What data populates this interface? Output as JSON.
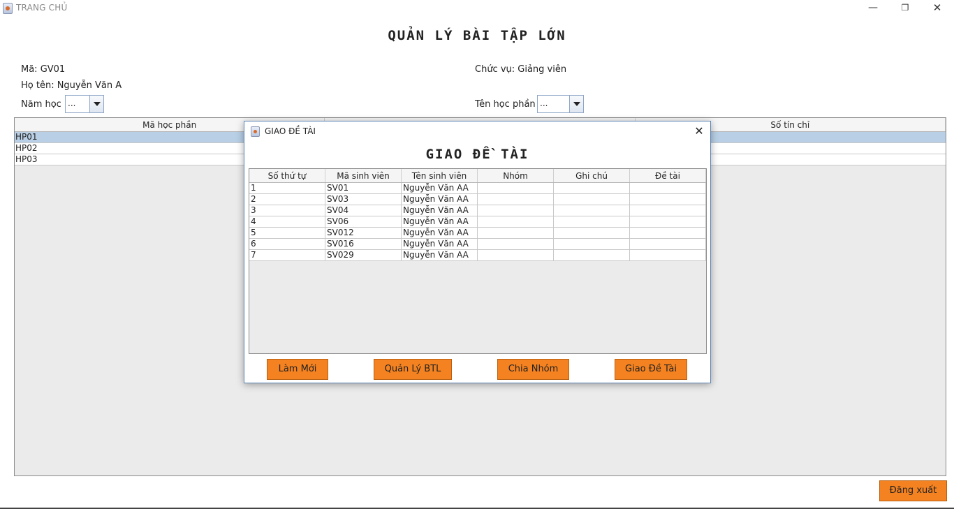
{
  "window": {
    "title": "TRANG CHỦ",
    "minimize": "—",
    "restore": "❐",
    "close": "✕"
  },
  "heading": "QUẢN LÝ BÀI TẬP LỚN",
  "info": {
    "ma": "Mã: GV01",
    "ho_ten": "Họ tên: Nguyễn Văn A",
    "chuc_vu": "Chức vụ: Giảng viên",
    "nam_hoc_label": "Năm học",
    "nam_hoc_value": "...",
    "ten_hoc_phan_label": "Tên học phần",
    "ten_hoc_phan_value": "..."
  },
  "main_table": {
    "columns": [
      "Mã học phần",
      "",
      "Số tín chỉ"
    ],
    "rows": [
      "HP01",
      "HP02",
      "HP03"
    ]
  },
  "logout_label": "Đăng xuất",
  "dialog": {
    "title": "GIAO ĐỀ TÀI",
    "close": "✕",
    "heading": "GIAO ĐỀ TÀI",
    "columns": [
      "Số thứ tự",
      "Mã sinh viên",
      "Tên sinh viên",
      "Nhóm",
      "Ghi chú",
      "Đề tài"
    ],
    "rows": [
      [
        "1",
        "SV01",
        "Nguyễn Văn AA",
        "",
        "",
        ""
      ],
      [
        "2",
        "SV03",
        "Nguyễn Văn AA",
        "",
        "",
        ""
      ],
      [
        "3",
        "SV04",
        "Nguyễn Văn AA",
        "",
        "",
        ""
      ],
      [
        "4",
        "SV06",
        "Nguyễn Văn AA",
        "",
        "",
        ""
      ],
      [
        "5",
        "SV012",
        "Nguyễn Văn AA",
        "",
        "",
        ""
      ],
      [
        "6",
        "SV016",
        "Nguyễn Văn AA",
        "",
        "",
        ""
      ],
      [
        "7",
        "SV029",
        "Nguyễn Văn AA",
        "",
        "",
        ""
      ]
    ],
    "buttons": {
      "lam_moi": "Làm Mới",
      "quan_ly_btl": "Quản Lý BTL",
      "chia_nhom": "Chia Nhóm",
      "giao_de_tai": "Giao Đề Tài"
    }
  },
  "colors": {
    "button_orange": "#f58220",
    "selected_row": "#b8cfe5",
    "table_bg": "#ebebeb"
  }
}
